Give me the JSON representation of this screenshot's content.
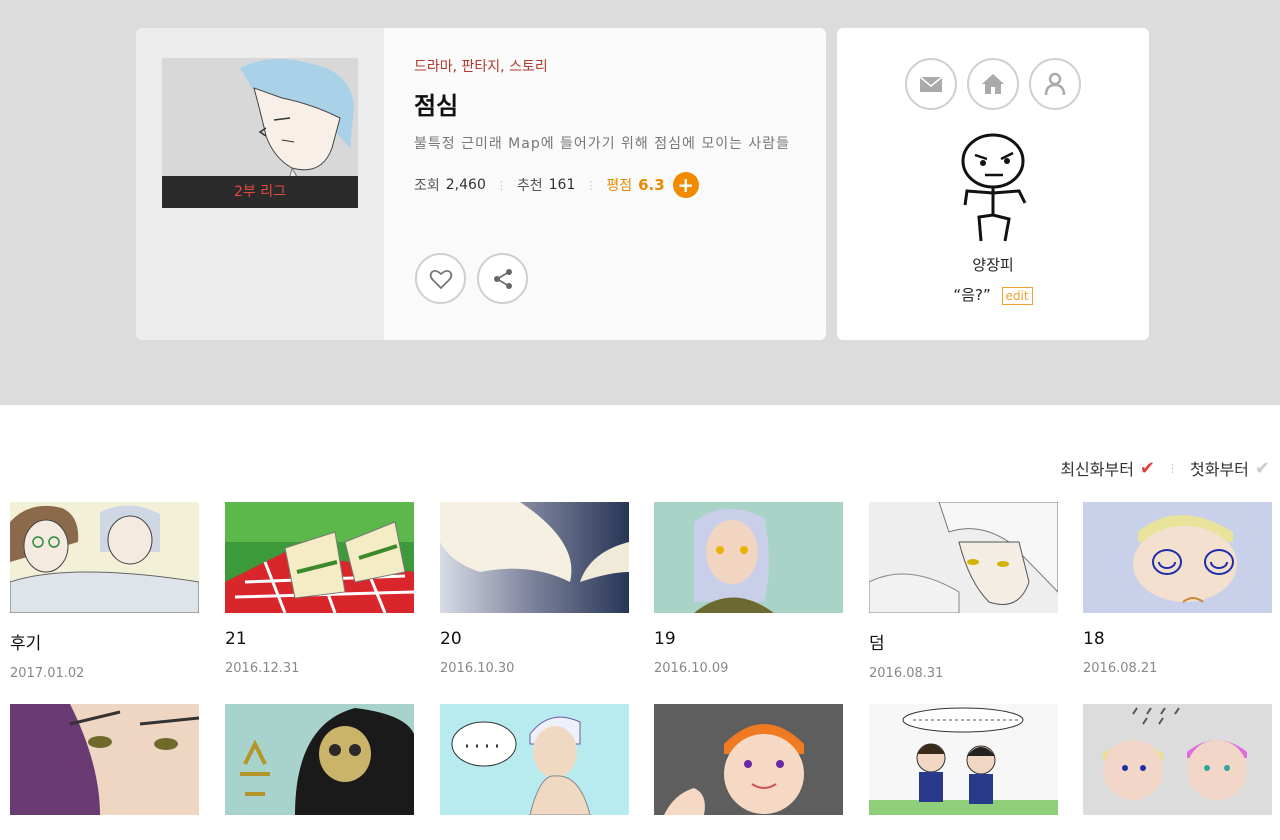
{
  "work": {
    "cover_caption": "2부 리그",
    "genre": "드라마, 판타지, 스토리",
    "title": "점심",
    "description": "불특정 근미래 Map에 들어가기 위해 점심에 모이는 사람들",
    "views_label": "조회",
    "views": "2,460",
    "recommend_label": "추천",
    "recommend": "161",
    "rating_label": "평점",
    "rating": "6.3",
    "rating_add": "+"
  },
  "author": {
    "name": "양장피",
    "quote": "“음?”",
    "edit_label": "edit"
  },
  "sort": {
    "newest": "최신화부터",
    "oldest": "첫화부터"
  },
  "episodes": [
    {
      "title": "후기",
      "date": "2017.01.02"
    },
    {
      "title": "21",
      "date": "2016.12.31"
    },
    {
      "title": "20",
      "date": "2016.10.30"
    },
    {
      "title": "19",
      "date": "2016.10.09"
    },
    {
      "title": "덤",
      "date": "2016.08.31"
    },
    {
      "title": "18",
      "date": "2016.08.21"
    }
  ],
  "colors": {
    "accent_orange": "#f28a00",
    "check_red": "#e0403a",
    "genre_red": "#b03a2e"
  },
  "icons": [
    "heart-icon",
    "share-icon",
    "mail-icon",
    "home-icon",
    "person-icon",
    "checkmark-icon"
  ]
}
